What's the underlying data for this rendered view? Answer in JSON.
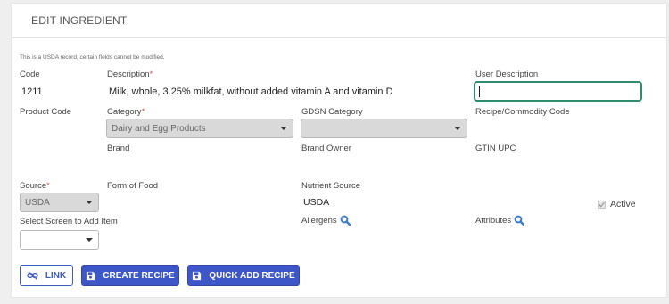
{
  "panel": {
    "title": "EDIT INGREDIENT",
    "usda_note": "This is a USDA record, certain fields cannot be modified."
  },
  "form": {
    "code_label": "Code",
    "code_value": "1211",
    "description_label": "Description",
    "description_value": "Milk, whole, 3.25% milkfat, without added vitamin A and vitamin D",
    "user_description_label": "User Description",
    "user_description_value": "",
    "product_code_label": "Product Code",
    "category_label": "Category",
    "category_value": "Dairy and Egg Products",
    "gdsn_label": "GDSN Category",
    "gdsn_value": "",
    "recipe_commodity_label": "Recipe/Commodity Code",
    "brand_label": "Brand",
    "brand_owner_label": "Brand Owner",
    "gtin_label": "GTIN UPC",
    "source_label": "Source",
    "source_value": "USDA",
    "form_of_food_label": "Form of Food",
    "nutrient_source_label": "Nutrient Source",
    "nutrient_source_value": "USDA",
    "active_label": "Active",
    "select_screen_label": "Select Screen to Add Item",
    "select_screen_value": "",
    "allergens_label": "Allergens",
    "attributes_label": "Attributes",
    "required_mark": "*"
  },
  "buttons": {
    "link": "LINK",
    "create_recipe": "CREATE RECIPE",
    "quick_add_recipe": "QUICK ADD RECIPE"
  },
  "colors": {
    "primary": "#3e57c8",
    "focus_border": "#2e8b6d",
    "required": "#d9534f",
    "search_icon": "#3d7cc9"
  }
}
